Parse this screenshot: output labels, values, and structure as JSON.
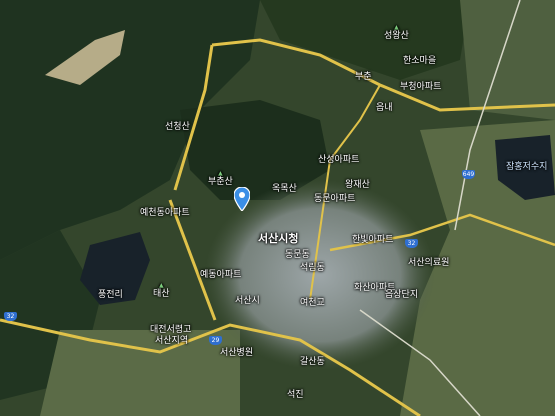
{
  "labels": {
    "seongwangsan": "성왕산",
    "hansoryumaeul": "한소마을",
    "buchun": "부춘",
    "bucheongapt": "부청아파트",
    "eupnae": "읍내",
    "seoncheongsan": "선청산",
    "bucheonsan": "부춘산",
    "okmoksan": "옥목산",
    "sanseongapt": "산성아파트",
    "jangdongreservoir": "잠홍저수지",
    "dongmunapt": "동문아파트",
    "hanjaesan": "왕재산",
    "yejeonhospital": "예천동아파트",
    "seosansi": "서산시청",
    "dongmun": "동문동",
    "hanbitapt": "한빛아파트",
    "seosanhospital": "서산의료원",
    "seokrim": "석림동",
    "yedongapt": "예동아파트",
    "hwasan": "화산아파트",
    "yeocheon": "여천교",
    "pungjeon": "풍전리",
    "taesan": "태산",
    "seosancity": "서산시",
    "daejeonseoryeong": "대전서령고",
    "seosangu": "서산지역",
    "eupsangdan": "읍상단지",
    "seoulhospital": "서산병원",
    "galsan": "갈산동",
    "seokjin": "석진"
  },
  "shields": {
    "r32_west": "32",
    "r32_east": "32",
    "r29": "29",
    "r649": "649"
  },
  "colors": {
    "highway": "#e0c24a",
    "road": "#d7d7c8",
    "water": "#1a2630",
    "urban": "#8f9aa0"
  }
}
